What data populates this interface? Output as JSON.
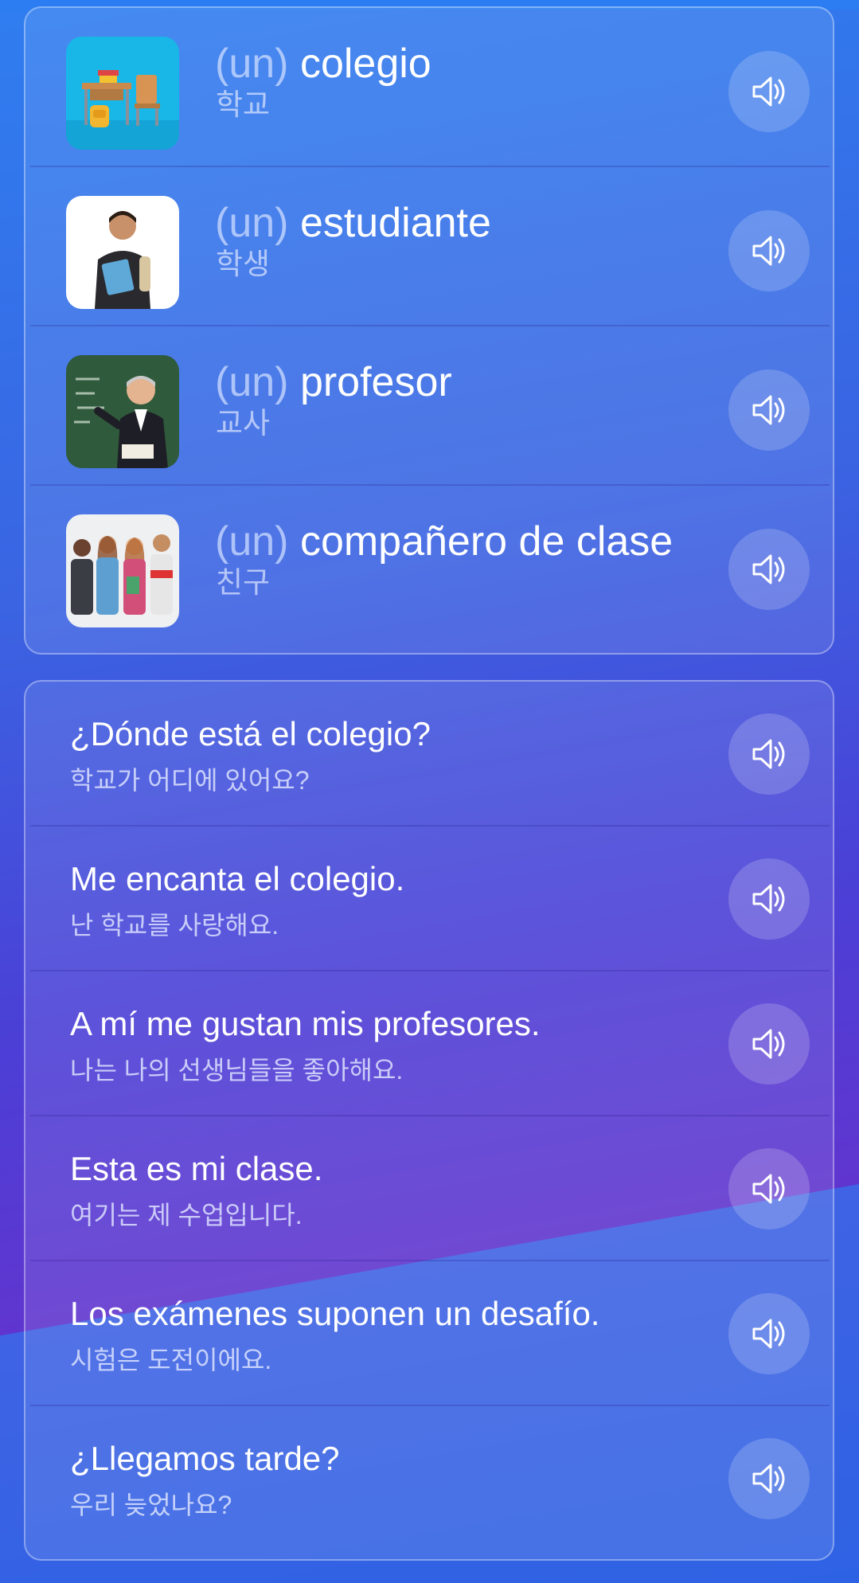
{
  "vocabulary": [
    {
      "article": "(un)",
      "word": "colegio",
      "translation": "학교",
      "image": "school-desk-image"
    },
    {
      "article": "(un)",
      "word": "estudiante",
      "translation": "학생",
      "image": "student-image"
    },
    {
      "article": "(un)",
      "word": "profesor",
      "translation": "교사",
      "image": "teacher-image"
    },
    {
      "article": "(un)",
      "word": "compañero de clase",
      "translation": "친구",
      "image": "classmates-image"
    }
  ],
  "phrases": [
    {
      "text": "¿Dónde está el colegio?",
      "translation": "학교가 어디에 있어요?"
    },
    {
      "text": "Me encanta el colegio.",
      "translation": "난 학교를 사랑해요."
    },
    {
      "text": "A mí me gustan mis profesores.",
      "translation": "나는 나의 선생님들을 좋아해요."
    },
    {
      "text": "Esta es mi clase.",
      "translation": "여기는 제 수업입니다."
    },
    {
      "text": "Los exámenes suponen un desafío.",
      "translation": "시험은 도전이에요."
    },
    {
      "text": "¿Llegamos tarde?",
      "translation": "우리 늦었나요?"
    }
  ],
  "icons": {
    "play": "speaker-icon"
  },
  "colors": {
    "accent": "#2f7ef0",
    "purple": "#6035cf"
  }
}
